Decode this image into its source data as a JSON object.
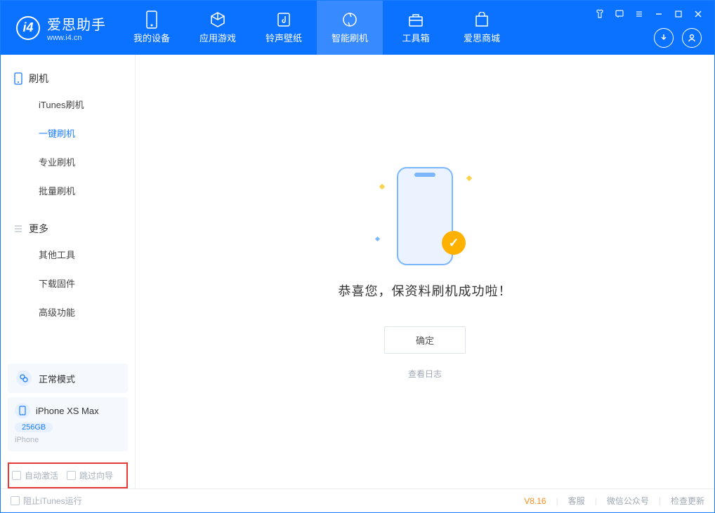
{
  "app": {
    "name_zh": "爱思助手",
    "name_en": "www.i4.cn"
  },
  "tabs": [
    {
      "label": "我的设备",
      "icon": "device"
    },
    {
      "label": "应用游戏",
      "icon": "cube"
    },
    {
      "label": "铃声壁纸",
      "icon": "music"
    },
    {
      "label": "智能刷机",
      "icon": "shield",
      "active": true
    },
    {
      "label": "工具箱",
      "icon": "toolbox"
    },
    {
      "label": "爱思商城",
      "icon": "store"
    }
  ],
  "sidebar": {
    "section1_title": "刷机",
    "section1_items": [
      {
        "label": "iTunes刷机"
      },
      {
        "label": "一键刷机",
        "active": true
      },
      {
        "label": "专业刷机"
      },
      {
        "label": "批量刷机"
      }
    ],
    "section2_title": "更多",
    "section2_items": [
      {
        "label": "其他工具"
      },
      {
        "label": "下载固件"
      },
      {
        "label": "高级功能"
      }
    ],
    "mode": "正常模式",
    "device_name": "iPhone XS Max",
    "device_capacity": "256GB",
    "device_type": "iPhone",
    "checkbox1": "自动激活",
    "checkbox2": "跳过向导"
  },
  "main": {
    "success_text": "恭喜您，保资料刷机成功啦！",
    "ok_button": "确定",
    "view_log": "查看日志"
  },
  "footer": {
    "stop_itunes": "阻止iTunes运行",
    "version": "V8.16",
    "support": "客服",
    "wechat": "微信公众号",
    "update": "检查更新"
  }
}
